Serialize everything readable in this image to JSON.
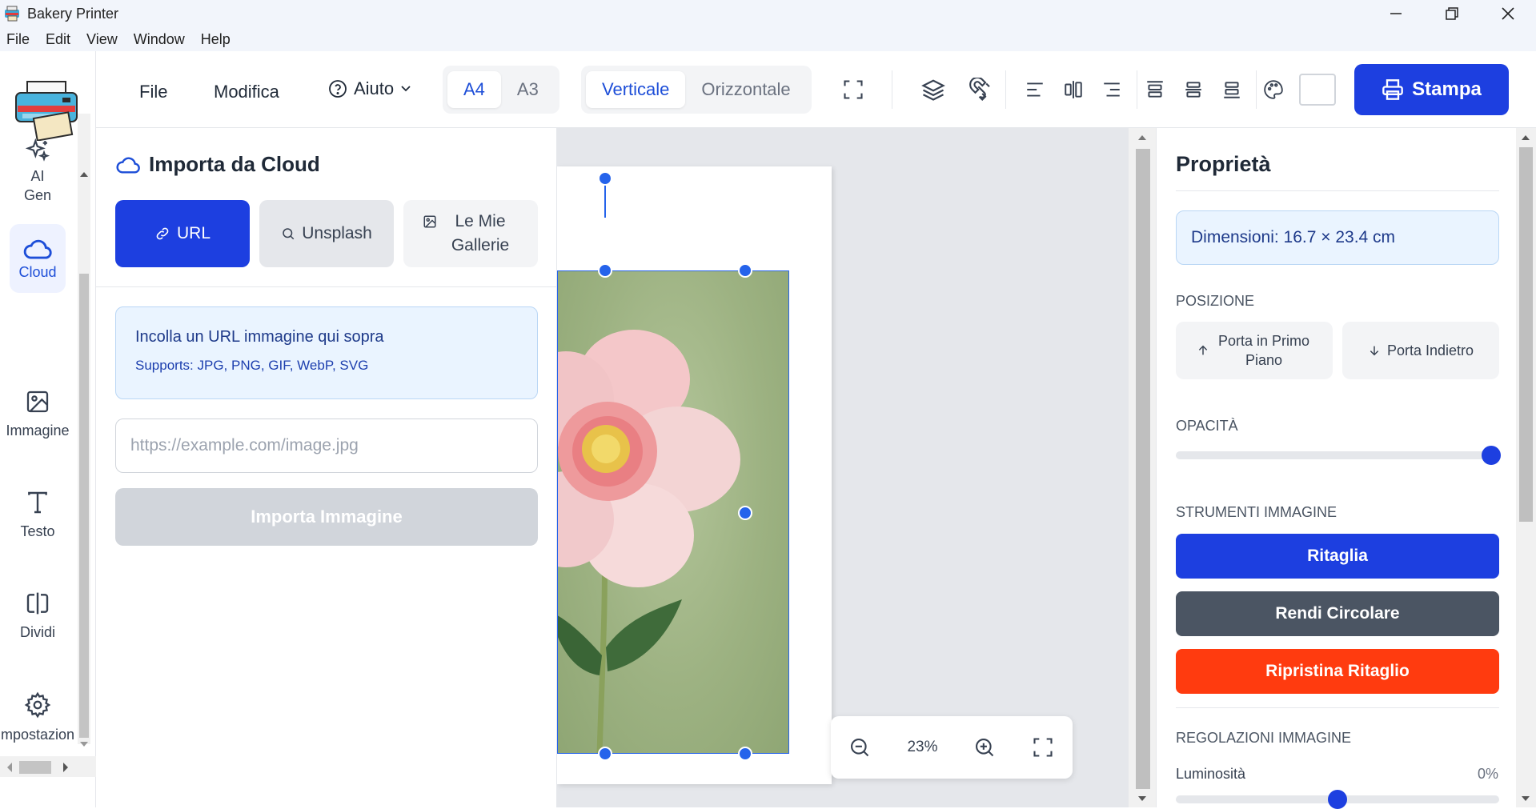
{
  "window": {
    "title": "Bakery Printer",
    "menu": [
      "File",
      "Edit",
      "View",
      "Window",
      "Help"
    ]
  },
  "rail": {
    "items": [
      {
        "label": "AI Gen",
        "icon": "sparkles-icon"
      },
      {
        "label": "Cloud",
        "icon": "cloud-icon"
      },
      {
        "label": "Immagine",
        "icon": "image-icon"
      },
      {
        "label": "Testo",
        "icon": "text-icon"
      },
      {
        "label": "Dividi",
        "icon": "split-icon"
      },
      {
        "label": "mpostazion",
        "icon": "gear-icon"
      }
    ]
  },
  "toolbar": {
    "file": "File",
    "edit": "Modifica",
    "help": "Aiuto",
    "paper_sizes": [
      "A4",
      "A3"
    ],
    "orientations": [
      "Verticale",
      "Orizzontale"
    ],
    "print": "Stampa",
    "accent": "#1d3fe0"
  },
  "cloud_panel": {
    "title": "Importa da Cloud",
    "tabs": {
      "url": "URL",
      "unsplash": "Unsplash",
      "galleries": "Le Mie Gallerie"
    },
    "info_main": "Incolla un URL immagine qui sopra",
    "info_sub": "Supports: JPG, PNG, GIF, WebP, SVG",
    "url_placeholder": "https://example.com/image.jpg",
    "url_value": "",
    "import_button": "Importa Immagine"
  },
  "canvas": {
    "zoom": "23%"
  },
  "properties": {
    "title": "Proprietà",
    "dimensions": "Dimensioni: 16.7 × 23.4 cm",
    "position_label": "POSIZIONE",
    "bring_front": "Porta in Primo Piano",
    "send_back": "Porta Indietro",
    "opacity_label": "OPACITÀ",
    "opacity_value": 1.0,
    "tools_label": "STRUMENTI IMMAGINE",
    "crop": "Ritaglia",
    "circle": "Rendi Circolare",
    "reset_crop": "Ripristina Ritaglio",
    "adjust_label": "REGOLAZIONI IMMAGINE",
    "brightness_label": "Luminosità",
    "brightness_value": "0%",
    "colors": {
      "crop": "#1d3fe0",
      "circle": "#4b5563",
      "reset": "#ff3b0f"
    }
  }
}
